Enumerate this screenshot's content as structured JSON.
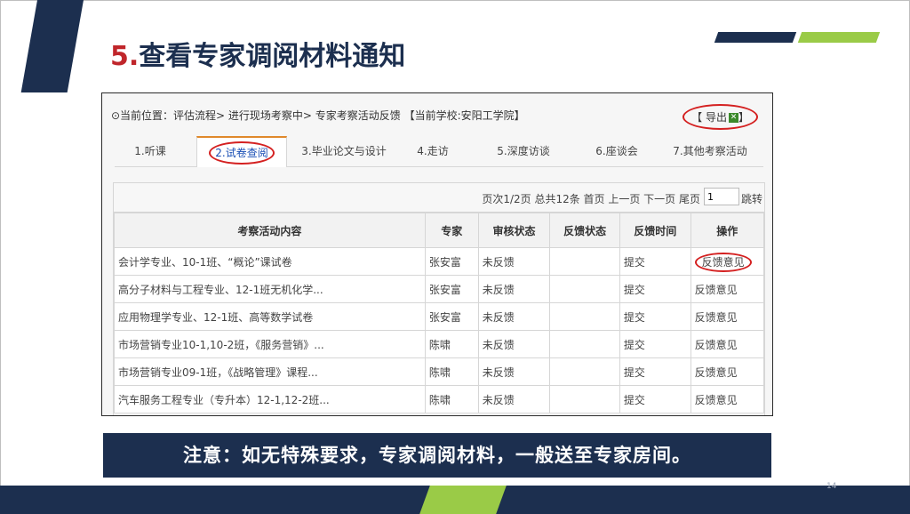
{
  "slide": {
    "title_number": "5.",
    "title_text": "查看专家调阅材料通知",
    "page_number": "14"
  },
  "screenshot": {
    "breadcrumb": "⊙当前位置：评估流程> 进行现场考察中> 专家考察活动反馈 【当前学校:安阳工学院】",
    "export_label": "【 导出",
    "export_tail": "】",
    "tabs": [
      {
        "label": "1.听课",
        "active": false
      },
      {
        "label": "2.试卷查阅",
        "active": true
      },
      {
        "label": "3.毕业论文与设计",
        "active": false
      },
      {
        "label": "4.走访",
        "active": false
      },
      {
        "label": "5.深度访谈",
        "active": false
      },
      {
        "label": "6.座谈会",
        "active": false
      },
      {
        "label": "7.其他考察活动",
        "active": false
      }
    ],
    "pager": {
      "text": "页次1/2页 总共12条 首页 上一页 下一页 尾页",
      "page_input": "1",
      "go_label": "跳转"
    },
    "table": {
      "headers": [
        "考察活动内容",
        "专家",
        "审核状态",
        "反馈状态",
        "反馈时间",
        "操作"
      ],
      "rows": [
        [
          "会计学专业、10-1班、“概论”课试卷",
          "张安富",
          "未反馈",
          "",
          "提交",
          "反馈意见"
        ],
        [
          "高分子材料与工程专业、12-1班无机化学...",
          "张安富",
          "未反馈",
          "",
          "提交",
          "反馈意见"
        ],
        [
          "应用物理学专业、12-1班、高等数学试卷",
          "张安富",
          "未反馈",
          "",
          "提交",
          "反馈意见"
        ],
        [
          "市场营销专业10-1,10-2班，《服务营销》...",
          "陈啸",
          "未反馈",
          "",
          "提交",
          "反馈意见"
        ],
        [
          "市场营销专业09-1班，《战略管理》课程...",
          "陈啸",
          "未反馈",
          "",
          "提交",
          "反馈意见"
        ],
        [
          "汽车服务工程专业（专升本）12-1,12-2班...",
          "陈啸",
          "未反馈",
          "",
          "提交",
          "反馈意见"
        ]
      ]
    }
  },
  "note": "注意：如无特殊要求，专家调阅材料，一般送至专家房间。",
  "colors": {
    "navy": "#1c2f4f",
    "green": "#9acb47",
    "title_red": "#c0262b",
    "highlight_red": "#d42020"
  }
}
